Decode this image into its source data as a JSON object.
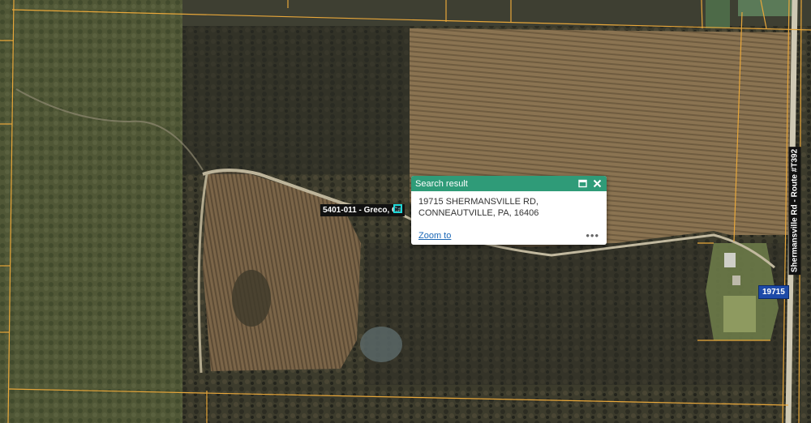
{
  "map": {
    "parcel_label": "5401-011 - Greco, Ca",
    "road_label": "Shermansville Rd - Route #T392",
    "house_number": "19715"
  },
  "popup": {
    "title": "Search result",
    "address_line1": "19715 SHERMANSVILLE RD,",
    "address_line2": "CONNEAUTVILLE, PA, 16406",
    "zoom_to_label": "Zoom to",
    "more_label": "•••",
    "header_color": "#2f9b78"
  },
  "colors": {
    "parcel_lines": "#e8a73a",
    "marker": "#1fd6d6"
  }
}
